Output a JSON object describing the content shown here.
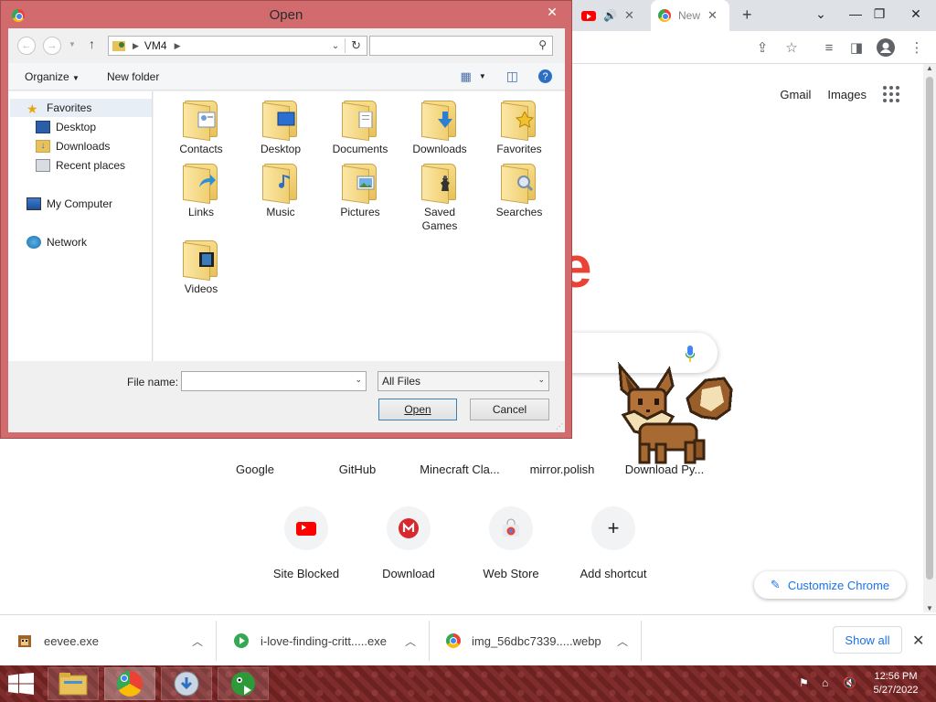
{
  "browser": {
    "tabs": [
      {
        "title": ""
      },
      {
        "title": "New"
      }
    ],
    "top_links": {
      "gmail": "Gmail",
      "images": "Images"
    },
    "shortcuts_row1": [
      {
        "label": "Google"
      },
      {
        "label": "GitHub"
      },
      {
        "label": "Minecraft Cla..."
      },
      {
        "label": "mirror.polish"
      },
      {
        "label": "Download Py..."
      }
    ],
    "shortcuts_row2": [
      {
        "label": "Site Blocked",
        "icon": "youtube-icon"
      },
      {
        "label": "Download",
        "icon": "mega-icon"
      },
      {
        "label": "Web Store",
        "icon": "chrome-webstore-icon"
      },
      {
        "label": "Add shortcut",
        "icon": "plus-icon"
      }
    ],
    "customize_label": "Customize Chrome"
  },
  "downloads": {
    "items": [
      {
        "name": "eevee.exe"
      },
      {
        "name": "i-love-finding-critt.....exe"
      },
      {
        "name": "img_56dbc7339.....webp"
      }
    ],
    "show_all": "Show all"
  },
  "dialog": {
    "title": "Open",
    "path": "VM4",
    "search_placeholder": "",
    "organize": "Organize",
    "new_folder": "New folder",
    "nav": {
      "favorites": "Favorites",
      "desktop": "Desktop",
      "downloads": "Downloads",
      "recent": "Recent places",
      "computer": "My Computer",
      "network": "Network"
    },
    "folders": [
      {
        "label": "Contacts"
      },
      {
        "label": "Desktop"
      },
      {
        "label": "Documents"
      },
      {
        "label": "Downloads"
      },
      {
        "label": "Favorites"
      },
      {
        "label": "Links"
      },
      {
        "label": "Music"
      },
      {
        "label": "Pictures"
      },
      {
        "label": "Saved Games"
      },
      {
        "label": "Searches"
      },
      {
        "label": "Videos"
      }
    ],
    "file_name_label": "File name:",
    "file_name_value": "",
    "file_type": "All Files",
    "open_btn": "Open",
    "cancel_btn": "Cancel"
  },
  "taskbar": {
    "time": "12:56 PM",
    "date": "5/27/2022"
  },
  "colors": {
    "dialog_frame": "#d26b6e",
    "taskbar": "#6d2222",
    "accent": "#1a73e8"
  }
}
